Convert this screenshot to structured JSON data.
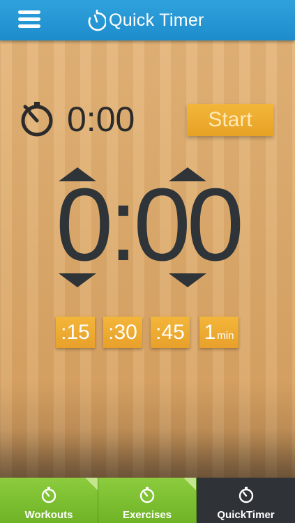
{
  "header": {
    "title": "Quick Timer",
    "menu_icon": "hamburger-icon",
    "logo_icon": "stopwatch-logo-icon"
  },
  "timer": {
    "elapsed": "0:00",
    "start_label": "Start",
    "big_time": "0:00"
  },
  "presets": [
    {
      "value": ":15",
      "unit": ""
    },
    {
      "value": ":30",
      "unit": ""
    },
    {
      "value": ":45",
      "unit": ""
    },
    {
      "value": "1",
      "unit": "min"
    }
  ],
  "tabs": [
    {
      "label": "Workouts",
      "icon": "stopwatch-icon",
      "active": false
    },
    {
      "label": "Exercises",
      "icon": "stopwatch-icon",
      "active": false
    },
    {
      "label": "QuickTimer",
      "icon": "stopwatch-icon",
      "active": true
    }
  ],
  "colors": {
    "header": "#2a9ad8",
    "accent": "#f0ad32",
    "tab_green": "#7bbf30",
    "tab_active": "#2f3337",
    "digits": "#2e3438"
  }
}
